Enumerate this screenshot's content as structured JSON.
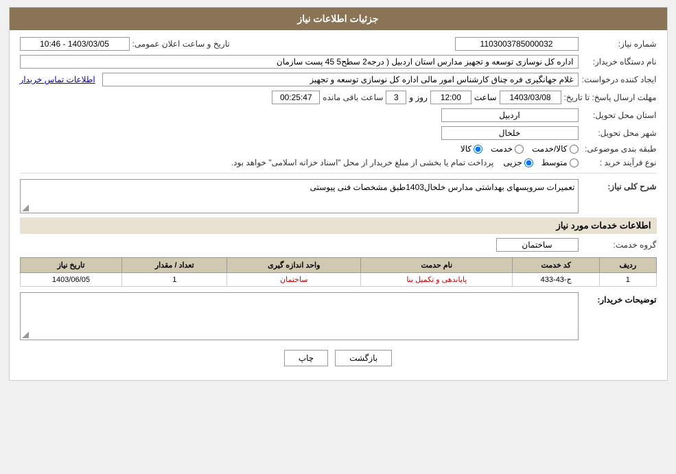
{
  "header": {
    "title": "جزئیات اطلاعات نیاز"
  },
  "fields": {
    "shomara_niaz_label": "شماره نیاز:",
    "shomara_niaz_value": "1103003785000032",
    "nam_dastgah_label": "نام دستگاه خریدار:",
    "nam_dastgah_value": "اداره کل نوسازی   توسعه و تجهیز مدارس استان اردبیل ( درجه2  سطح5  45 پست سازمان",
    "ijad_konande_label": "ایجاد کننده درخواست:",
    "ijad_konande_value": "غلام جهانگیری فره چناق کارشناس امور مالی اداره کل نوسازی   توسعه و تجهیز",
    "ettelaat_tamas_label": "اطلاعات تماس خریدار",
    "mohlat_ersal_label": "مهلت ارسال پاسخ: تا تاریخ:",
    "date_value": "1403/03/08",
    "time_value": "12:00",
    "days_label": "روز و",
    "days_value": "3",
    "remain_label": "ساعت باقی مانده",
    "remain_value": "00:25:47",
    "ostan_label": "استان محل تحویل:",
    "ostan_value": "اردبیل",
    "shahr_label": "شهر محل تحویل:",
    "shahr_value": "خلخال",
    "tabaqe_label": "طبقه بندی موضوعی:",
    "radio_kala": "کالا",
    "radio_khedmat": "خدمت",
    "radio_kala_khedmat": "کالا/خدمت",
    "no_farayand_label": "نوع فرآیند خرید :",
    "radio_jozii": "جزیی",
    "radio_motevaset": "متوسط",
    "farayand_desc": "پرداخت تمام یا بخشی از مبلغ خریدار از محل \"اسناد خزانه اسلامی\" خواهد بود.",
    "sharh_label": "شرح کلی نیاز:",
    "sharh_value": "تعمیرات سرویسهای بهداشتی  مدارس خلخال1403طبق مشخصات فنی پیوستی",
    "khadamat_label": "اطلاعات خدمات مورد نیاز",
    "gorohe_khedmat_label": "گروه خدمت:",
    "gorohe_khedmat_value": "ساختمان",
    "table": {
      "headers": [
        "ردیف",
        "کد خدمت",
        "نام حدمت",
        "واحد اندازه گیری",
        "تعداد / مقدار",
        "تاریخ نیاز"
      ],
      "rows": [
        {
          "radif": "1",
          "kod_khedmat": "ج-43-433",
          "nam_khedmat": "پایانده‍ی و تکمیل بنا",
          "vahed": "ساختمان",
          "tedad": "1",
          "tarikh": "1403/06/05"
        }
      ]
    },
    "tavzihat_label": "توضیحات خریدار:",
    "tavzihat_value": "",
    "btn_print": "چاپ",
    "btn_back": "بازگشت",
    "announce_label": "تاریخ و ساعت اعلان عمومی:",
    "announce_value": "1403/03/05 - 10:46"
  }
}
